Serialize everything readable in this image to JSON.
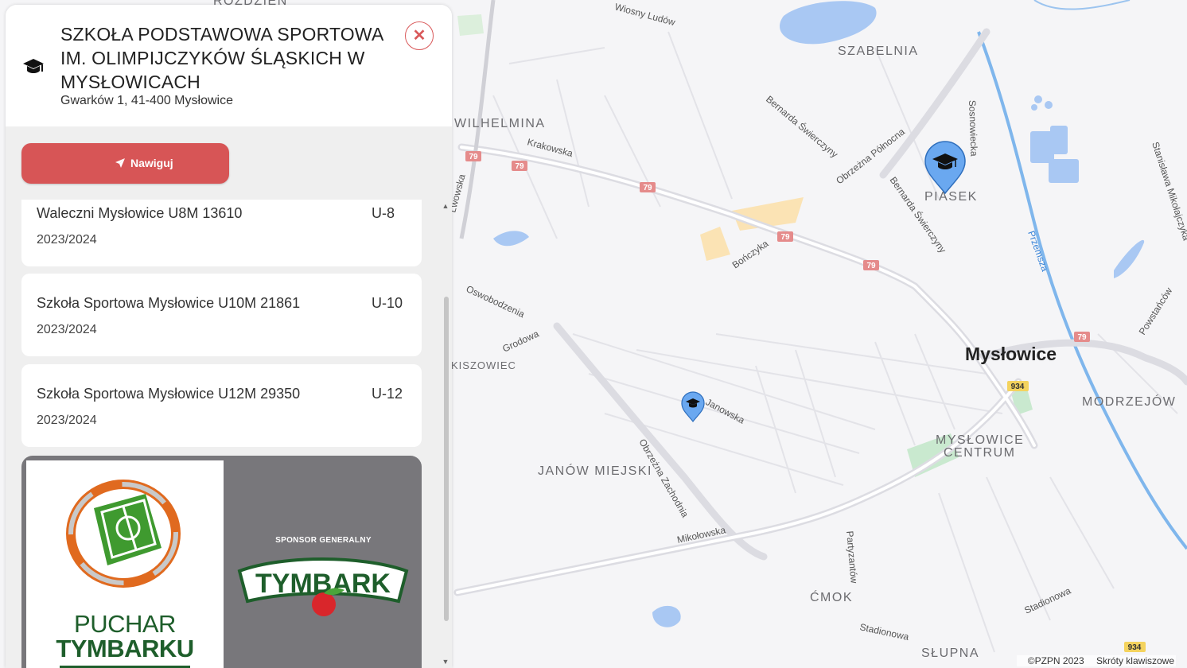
{
  "school": {
    "title": "SZKOŁA PODSTAWOWA SPORTOWA IM. OLIMPIJCZYKÓW ŚLĄSKICH W MYSŁOWICACH",
    "address": "Gwarków 1, 41-400 Mysłowice"
  },
  "icons": {
    "school": "graduation-cap-icon",
    "close": "close-icon",
    "navigate": "navigation-arrow-icon"
  },
  "actions": {
    "close_symbol": "✕",
    "navigate_label": "Nawiguj"
  },
  "teams": [
    {
      "name": "Waleczni Mysłowice U8M 13610",
      "category": "U-8",
      "season": "2023/2024"
    },
    {
      "name": "Szkoła Sportowa Mysłowice U10M 21861",
      "category": "U-10",
      "season": "2023/2024"
    },
    {
      "name": "Szkoła Sportowa Mysłowice U12M 29350",
      "category": "U-12",
      "season": "2023/2024"
    }
  ],
  "banner": {
    "puchar_line1": "PUCHAR",
    "puchar_line2": "TYMBARKU",
    "sponsor_label": "SPONSOR GENERALNY",
    "tymbark": "TYMBARK"
  },
  "map": {
    "districts": [
      "ROZDZIEŃ",
      "SZABELNIA",
      "WILHELMINA",
      "PIASEK",
      "KISZOWIEC",
      "MODRZEJÓW",
      "MYSŁOWICE",
      "CENTRUM",
      "JANÓW MIEJSKI",
      "ĆMOK",
      "SŁUPNA"
    ],
    "city": "Mysłowice",
    "streets": [
      "Wiosny Ludów",
      "Krakowska",
      "Lwowska",
      "Bernarda Świerczyny",
      "Obrzeżna Północna",
      "Sosnowiecka",
      "Stanisława Mikołajczyka",
      "Przemsza",
      "Bończyka",
      "Oswobodzenia",
      "Grodowa",
      "Janowska",
      "Obrzeżna Zachodnia",
      "Mikołowska",
      "Partyzantów",
      "Stadionowa",
      "Powstańców"
    ],
    "road_numbers": [
      "79",
      "934"
    ],
    "copyright": "©PZPN 2023",
    "shortcuts": "Skróty klawiszowe"
  },
  "colors": {
    "accent": "#d75556",
    "marker": "#6aa8f0",
    "river": "#5aa7e8",
    "tymbark_green": "#1e5e2b"
  }
}
